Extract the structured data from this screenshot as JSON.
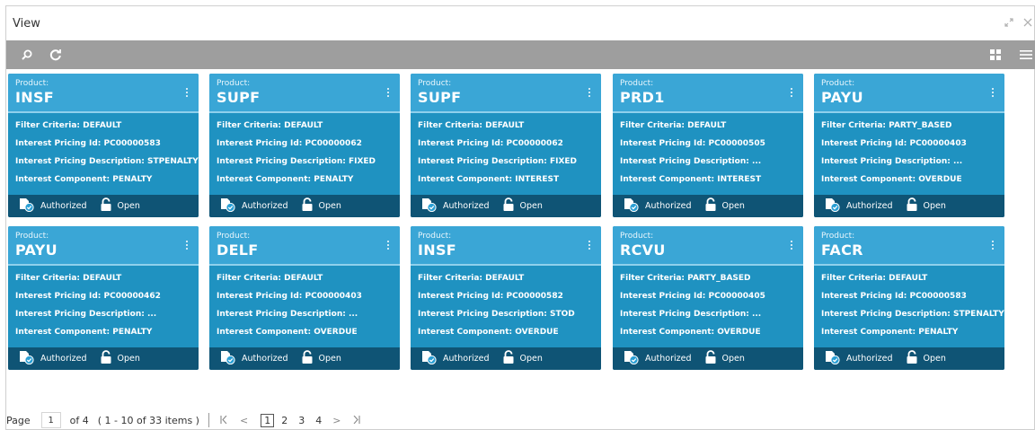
{
  "window": {
    "title": "View"
  },
  "toolbar": {
    "search_icon": "search-icon",
    "refresh_icon": "refresh-icon",
    "grid_icon": "grid-view-icon",
    "list_icon": "list-view-icon"
  },
  "labels": {
    "product": "Product:",
    "filter": "Filter Criteria: ",
    "pricing_id": "Interest Pricing Id: ",
    "pricing_desc": "Interest Pricing Description: ",
    "component": "Interest Component: ",
    "authorized": "Authorized",
    "open": "Open"
  },
  "cards": [
    {
      "product": "INSF",
      "filter": "DEFAULT",
      "pricing_id": "PC00000583",
      "pricing_desc": "STPENALTY",
      "component": "PENALTY"
    },
    {
      "product": "SUPF",
      "filter": "DEFAULT",
      "pricing_id": "PC00000062",
      "pricing_desc": "FIXED",
      "component": "PENALTY"
    },
    {
      "product": "SUPF",
      "filter": "DEFAULT",
      "pricing_id": "PC00000062",
      "pricing_desc": "FIXED",
      "component": "INTEREST"
    },
    {
      "product": "PRD1",
      "filter": "DEFAULT",
      "pricing_id": "PC00000505",
      "pricing_desc": "...",
      "component": "INTEREST"
    },
    {
      "product": "PAYU",
      "filter": "PARTY_BASED",
      "pricing_id": "PC00000403",
      "pricing_desc": "...",
      "component": "OVERDUE"
    },
    {
      "product": "PAYU",
      "filter": "DEFAULT",
      "pricing_id": "PC00000462",
      "pricing_desc": "...",
      "component": "PENALTY"
    },
    {
      "product": "DELF",
      "filter": "DEFAULT",
      "pricing_id": "PC00000403",
      "pricing_desc": "...",
      "component": "OVERDUE"
    },
    {
      "product": "INSF",
      "filter": "DEFAULT",
      "pricing_id": "PC00000582",
      "pricing_desc": "STOD",
      "component": "OVERDUE"
    },
    {
      "product": "RCVU",
      "filter": "PARTY_BASED",
      "pricing_id": "PC00000405",
      "pricing_desc": "...",
      "component": "OVERDUE"
    },
    {
      "product": "FACR",
      "filter": "DEFAULT",
      "pricing_id": "PC00000583",
      "pricing_desc": "STPENALTY",
      "component": "PENALTY"
    }
  ],
  "pager": {
    "page_label": "Page",
    "current_page": "1",
    "of_label": "of 4",
    "items_label": "( 1 - 10 of 33 items )",
    "pages": [
      "1",
      "2",
      "3",
      "4"
    ],
    "first": "K",
    "prev": "<",
    "next": ">",
    "last": "K"
  }
}
